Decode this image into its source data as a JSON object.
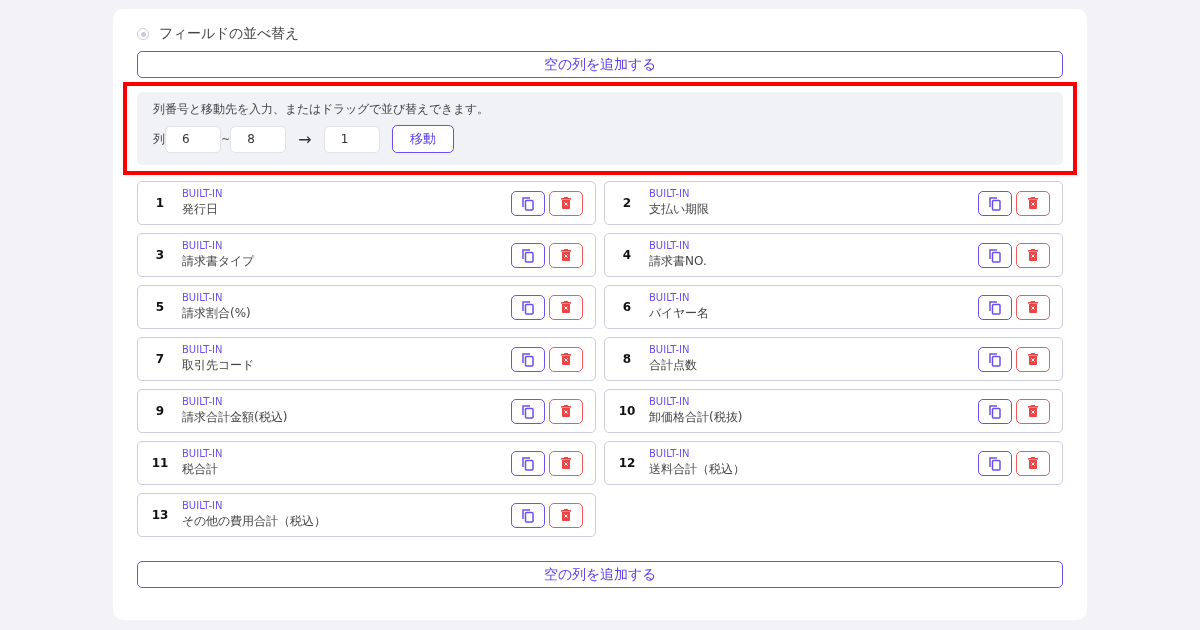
{
  "section": {
    "title": "フィールドの並べ替え",
    "radio_selected": true
  },
  "add_button_top": "空の列を追加する",
  "move_panel": {
    "highlighted": true,
    "hint": "列番号と移動先を入力、またはドラッグで並び替えできます。",
    "column_label": "列",
    "from": "6",
    "range_sep": "~",
    "to": "8",
    "arrow": "→",
    "target": "1",
    "move_button": "移動"
  },
  "fields": [
    {
      "number": "1",
      "tag": "BUILT-IN",
      "name": "発行日"
    },
    {
      "number": "2",
      "tag": "BUILT-IN",
      "name": "支払い期限"
    },
    {
      "number": "3",
      "tag": "BUILT-IN",
      "name": "請求書タイプ"
    },
    {
      "number": "4",
      "tag": "BUILT-IN",
      "name": "請求書NO."
    },
    {
      "number": "5",
      "tag": "BUILT-IN",
      "name": "請求割合(%)"
    },
    {
      "number": "6",
      "tag": "BUILT-IN",
      "name": "バイヤー名"
    },
    {
      "number": "7",
      "tag": "BUILT-IN",
      "name": "取引先コード"
    },
    {
      "number": "8",
      "tag": "BUILT-IN",
      "name": "合計点数"
    },
    {
      "number": "9",
      "tag": "BUILT-IN",
      "name": "請求合計金額(税込)"
    },
    {
      "number": "10",
      "tag": "BUILT-IN",
      "name": "卸価格合計(税抜)"
    },
    {
      "number": "11",
      "tag": "BUILT-IN",
      "name": "税合計"
    },
    {
      "number": "12",
      "tag": "BUILT-IN",
      "name": "送料合計（税込）"
    },
    {
      "number": "13",
      "tag": "BUILT-IN",
      "name": "その他の費用合計（税込）"
    }
  ],
  "add_button_bottom": "空の列を追加する"
}
